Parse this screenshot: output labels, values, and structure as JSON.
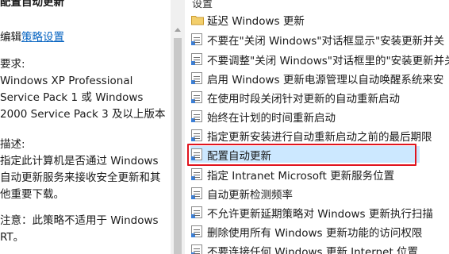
{
  "left": {
    "title": "配置自动更新",
    "edit_prefix": "编辑",
    "edit_link": "策略设置",
    "requirements_lines": [
      "要求:",
      "Windows XP Professional",
      "Service Pack 1 或 Windows",
      "2000 Service Pack 3 及以上版本"
    ],
    "description_lines": [
      "描述:",
      "指定此计算机是否通过 Windows",
      "自动更新服务来接收安全更新和其",
      "他重要下载。"
    ],
    "note_lines": [
      "注意：此策略不适用于 Windows",
      "RT。"
    ]
  },
  "list": {
    "header": "设置",
    "items": [
      {
        "type": "folder",
        "label": "延迟 Windows 更新"
      },
      {
        "type": "policy",
        "label": "不要在\"关闭 Windows\"对话框显示\"安装更新并关"
      },
      {
        "type": "policy",
        "label": "不要调整\"关闭 Windows\"对话框里的\"安装更新并关"
      },
      {
        "type": "policy",
        "label": "启用 Windows 更新电源管理以自动唤醒系统来安"
      },
      {
        "type": "policy",
        "label": "在使用时段关闭针对更新的自动重新启动"
      },
      {
        "type": "policy",
        "label": "始终在计划的时间重新启动"
      },
      {
        "type": "policy",
        "label": "指定更新安装进行自动重新启动之前的最后期限"
      },
      {
        "type": "policy",
        "label": "配置自动更新",
        "selected": true
      },
      {
        "type": "policy",
        "label": "指定 Intranet Microsoft 更新服务位置"
      },
      {
        "type": "policy",
        "label": "自动更新检测频率"
      },
      {
        "type": "policy",
        "label": "不允许更新延期策略对 Windows 更新执行扫描"
      },
      {
        "type": "policy",
        "label": "删除使用所有 Windows 更新功能的访问权限"
      },
      {
        "type": "policy",
        "label": "不要连接任何 Windows 更新 Internet 位置"
      }
    ]
  },
  "colors": {
    "link": "#0563c1",
    "selection": "#cce8ff",
    "highlight_box": "#e0141e",
    "folder": "#e8b64a"
  }
}
